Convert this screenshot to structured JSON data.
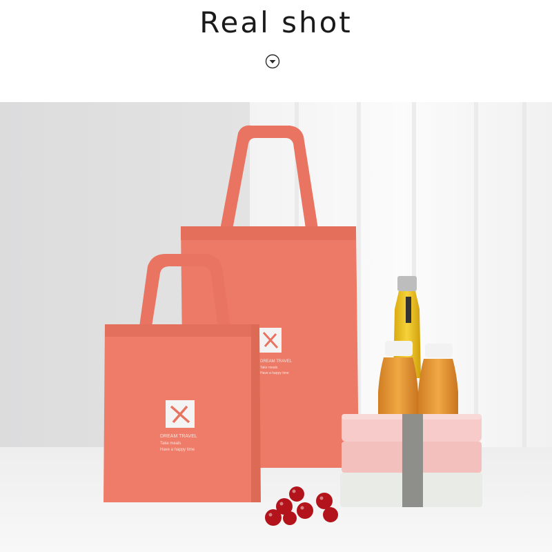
{
  "header": {
    "title": "Real shot"
  },
  "icons": {
    "scroll_indicator": "chevron-down-circle-icon"
  },
  "photo": {
    "bag_large_text": [
      "DREAM TRAVEL",
      "Take meals",
      "Have a happy time"
    ],
    "bag_small_text": [
      "DREAM TRAVEL",
      "Take meals",
      "Have a happy time"
    ]
  },
  "colors": {
    "bag": "#ec7a66",
    "bag_shadow": "#d9664f",
    "lunchbox_top": "#f6c6c4",
    "lunchbox_bottom": "#e9ebe7",
    "strap": "#8e8e8b",
    "juice": "#e79a33",
    "tomato": "#b3141b"
  }
}
